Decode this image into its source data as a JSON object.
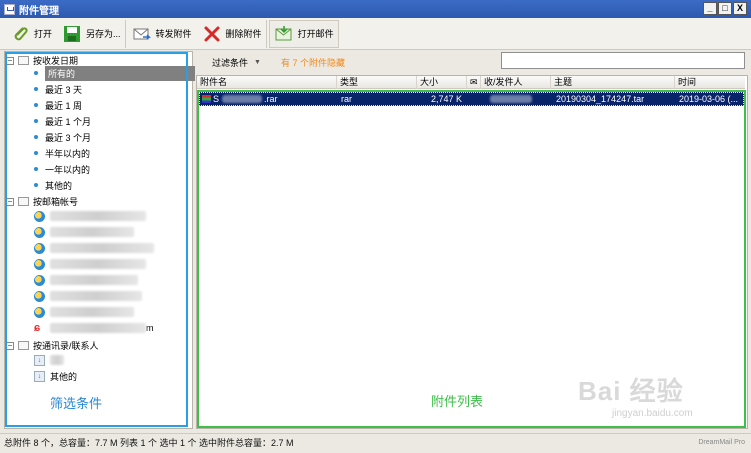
{
  "window": {
    "title": "附件管理",
    "controls": [
      "_",
      "□",
      "X"
    ]
  },
  "toolbar": {
    "open": "打开",
    "save_as": "另存为...",
    "forward": "转发附件",
    "delete": "删除附件",
    "open_mail": "打开邮件"
  },
  "tree": {
    "by_date": {
      "label": "按收发日期",
      "items": [
        "所有的",
        "最近 3 天",
        "最近 1 周",
        "最近 1 个月",
        "最近 3 个月",
        "半年以内的",
        "一年以内的",
        "其他的"
      ]
    },
    "by_account": {
      "label": "按邮箱帐号",
      "accounts": [
        "",
        "",
        "",
        "",
        "",
        "",
        "",
        "m"
      ]
    },
    "by_contact": {
      "label": "按通讯录/联系人",
      "items": [
        "",
        "其他的"
      ]
    }
  },
  "filter": {
    "label": "过滤条件",
    "hidden_note": "有 7 个附件隐藏",
    "search_value": ""
  },
  "columns": [
    "附件名",
    "类型",
    "大小",
    "收/发件人",
    "主题",
    "时间"
  ],
  "rows": [
    {
      "name_prefix": "S",
      "name_suffix": ".rar",
      "type": "rar",
      "size": "2,747 K",
      "sender": "",
      "subject": "20190304_174247.tar",
      "time": "2019-03-06 (..."
    }
  ],
  "annotations": {
    "left": "筛选条件",
    "right": "附件列表"
  },
  "status": "总附件 8 个，总容量：7.7 M   列表 1 个  选中 1 个  选中附件总容量：2.7 M",
  "brand": "DreamMail Pro",
  "watermark": {
    "main": "Bai 经验",
    "sub": "jingyan.baidu.com"
  }
}
